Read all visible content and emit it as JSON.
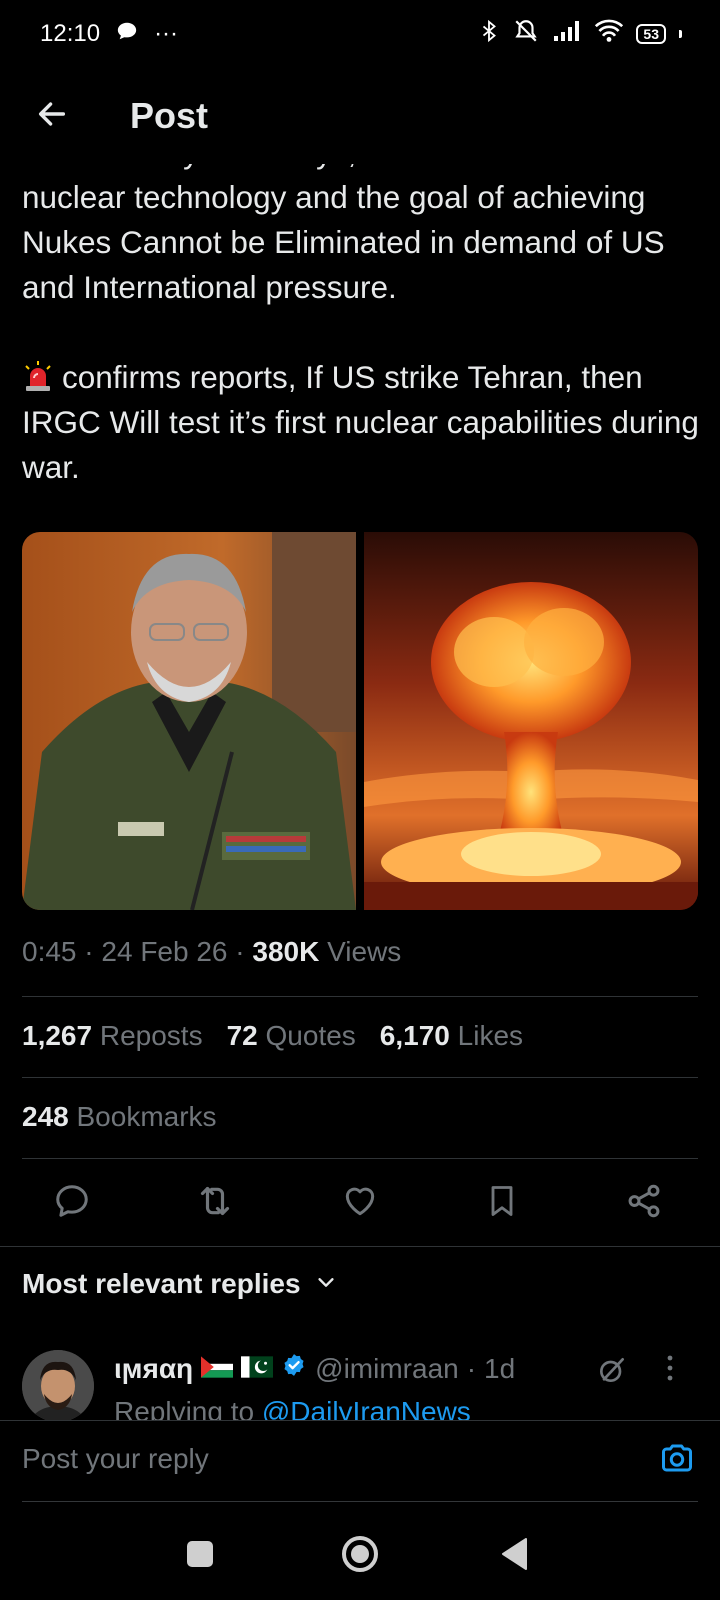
{
  "status_bar": {
    "time": "12:10",
    "more": "···",
    "battery": "53",
    "icons": [
      "chat-bubble-icon",
      "bluetooth-icon",
      "vibrate-icon",
      "signal-icon",
      "wifi-icon",
      "battery-icon"
    ]
  },
  "header": {
    "title": "Post",
    "back_icon": "arrow-left-icon"
  },
  "post": {
    "partial_line": "Iranian Army chief says, Iran",
    "paragraph1": "nuclear technology and the goal of achieving Nukes Cannot be Eliminated in demand of US and International pressure.",
    "paragraph2": "confirms reports, If US strike Tehran, then IRGC Will test it’s first nuclear capabilities during war.",
    "paragraph2_emoji": "siren-icon"
  },
  "media": {
    "images": [
      "photo-military-officer",
      "photo-nuclear-explosion"
    ]
  },
  "meta": {
    "time": "0:45",
    "date": "24 Feb 26",
    "views_count": "380K",
    "views_label": "Views",
    "sep": "·"
  },
  "stats": {
    "reposts_count": "1,267",
    "reposts_label": "Reposts",
    "quotes_count": "72",
    "quotes_label": "Quotes",
    "likes_count": "6,170",
    "likes_label": "Likes",
    "bookmarks_count": "248",
    "bookmarks_label": "Bookmarks"
  },
  "actions": [
    "reply-icon",
    "repost-icon",
    "like-icon",
    "bookmark-icon",
    "share-icon"
  ],
  "replies": {
    "sort_label": "Most relevant replies",
    "items": [
      {
        "name": "ιϻяαη",
        "handle": "@imimraan",
        "time": "1d",
        "sep": "·",
        "replying_prefix": "Replying to",
        "replying_to": "@DailyIranNews"
      }
    ]
  },
  "composer": {
    "placeholder": "Post your reply"
  },
  "colors": {
    "background": "#000000",
    "text": "#e7e9ea",
    "secondary": "#71767b",
    "accent": "#1d9bf0",
    "divider": "#2f3336"
  }
}
